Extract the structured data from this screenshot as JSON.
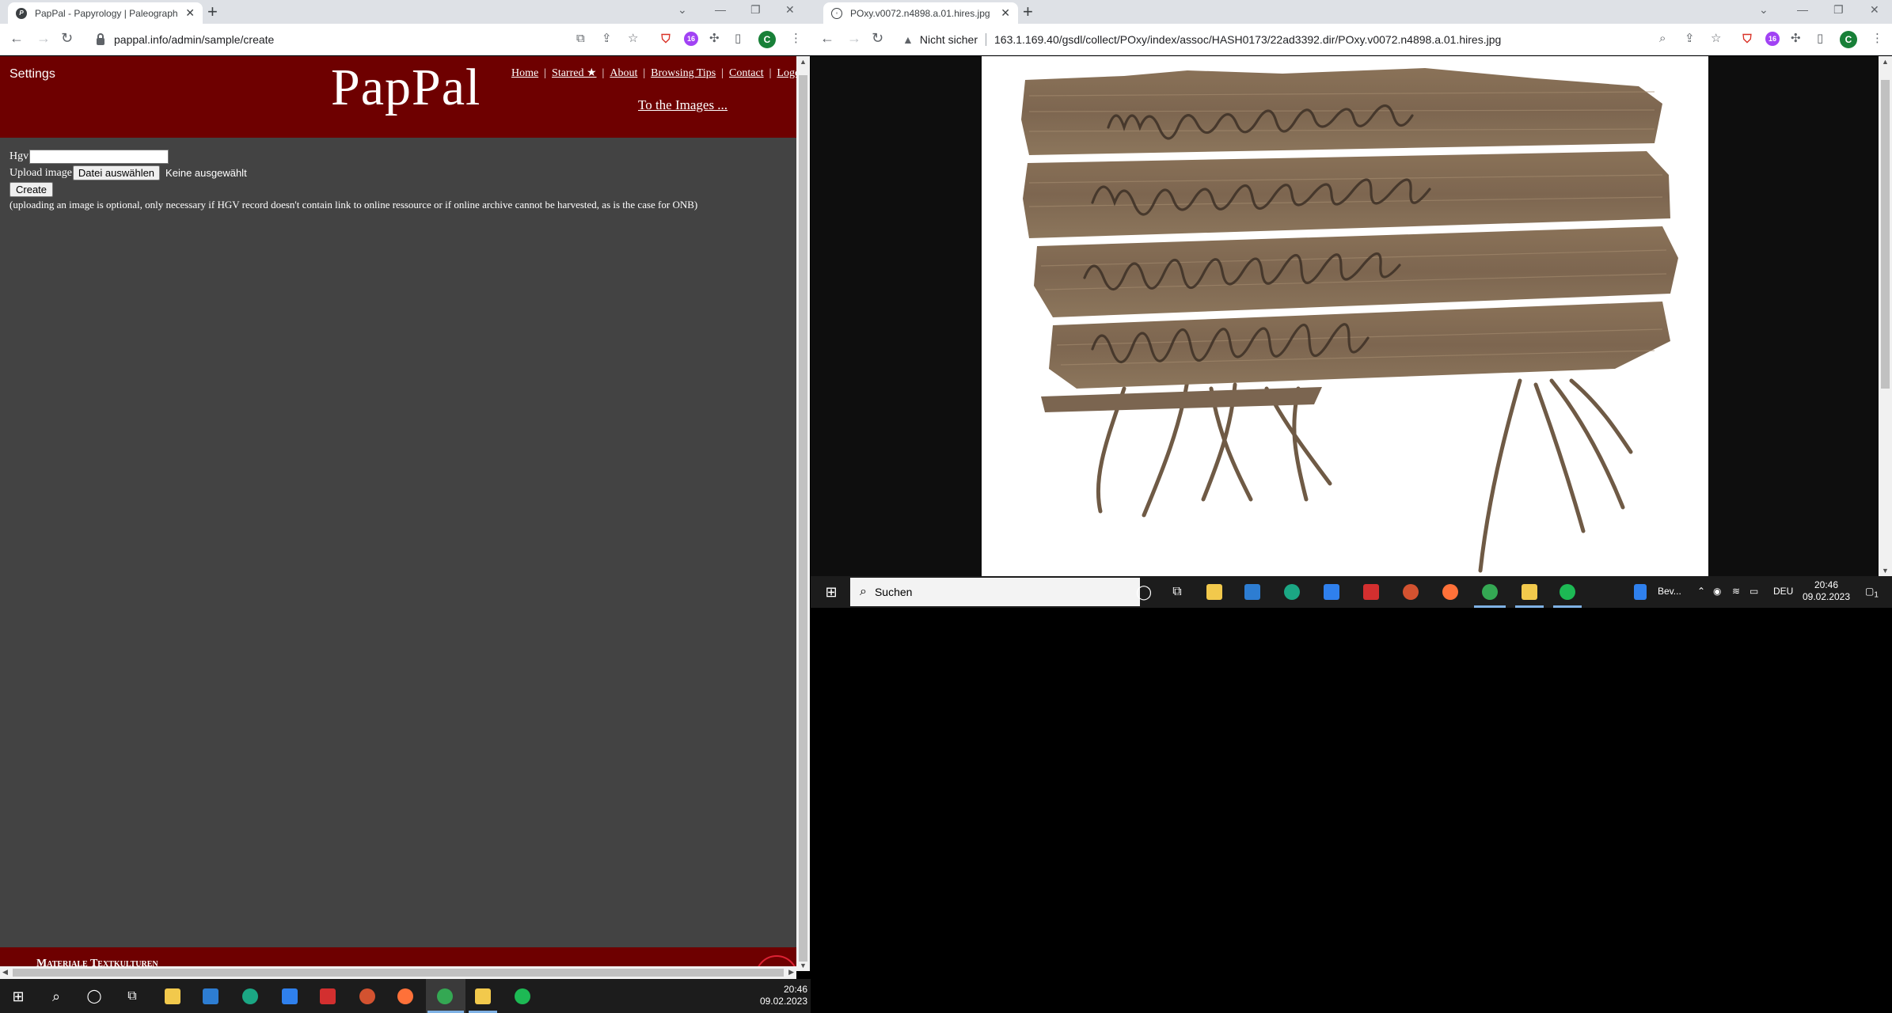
{
  "left_window": {
    "tab_title": "PapPal - Papyrology | Paleograph",
    "url": "pappal.info/admin/sample/create",
    "site": {
      "settings_label": "Settings",
      "logo": "PapPal",
      "nav": [
        "Home",
        "Starred ★",
        "About",
        "Browsing Tips",
        "Contact",
        "Logou"
      ],
      "nav_sep": "|",
      "to_images": "To the Images ...",
      "form": {
        "hgv_label": "Hgv",
        "hgv_value": "",
        "upload_label": "Upload image",
        "file_button": "Datei auswählen",
        "file_status": "Keine ausgewählt",
        "create_button": "Create",
        "note": "(uploading an image is optional, only necessary if HGV record doesn't contain link to online ressource or if online archive cannot be harvested, as is the case for ONB)"
      },
      "footer_text": "Materiale Textkulturen"
    },
    "avatar_letter": "C",
    "extension_label": "16"
  },
  "right_window": {
    "tab_title": "POxy.v0072.n4898.a.01.hires.jpg",
    "security_label": "Nicht sicher",
    "url": "163.1.169.40/gsdl/collect/POxy/index/assoc/HASH0173/22ad3392.dir/POxy.v0072.n4898.a.01.hires.jpg",
    "avatar_letter": "C",
    "extension_label": "16"
  },
  "inner_taskbar": {
    "search_placeholder": "Suchen",
    "bev_label": "Bev...",
    "language": "DEU",
    "time": "20:46",
    "date": "09.02.2023",
    "notification_count": "1"
  },
  "outer_taskbar": {
    "time": "20:46",
    "date": "09.02.2023"
  },
  "colors": {
    "pappal_red": "#6e0000",
    "page_gray": "#434343",
    "chrome_tabstrip": "#dee1e6",
    "taskbar": "#1c1c1c"
  }
}
